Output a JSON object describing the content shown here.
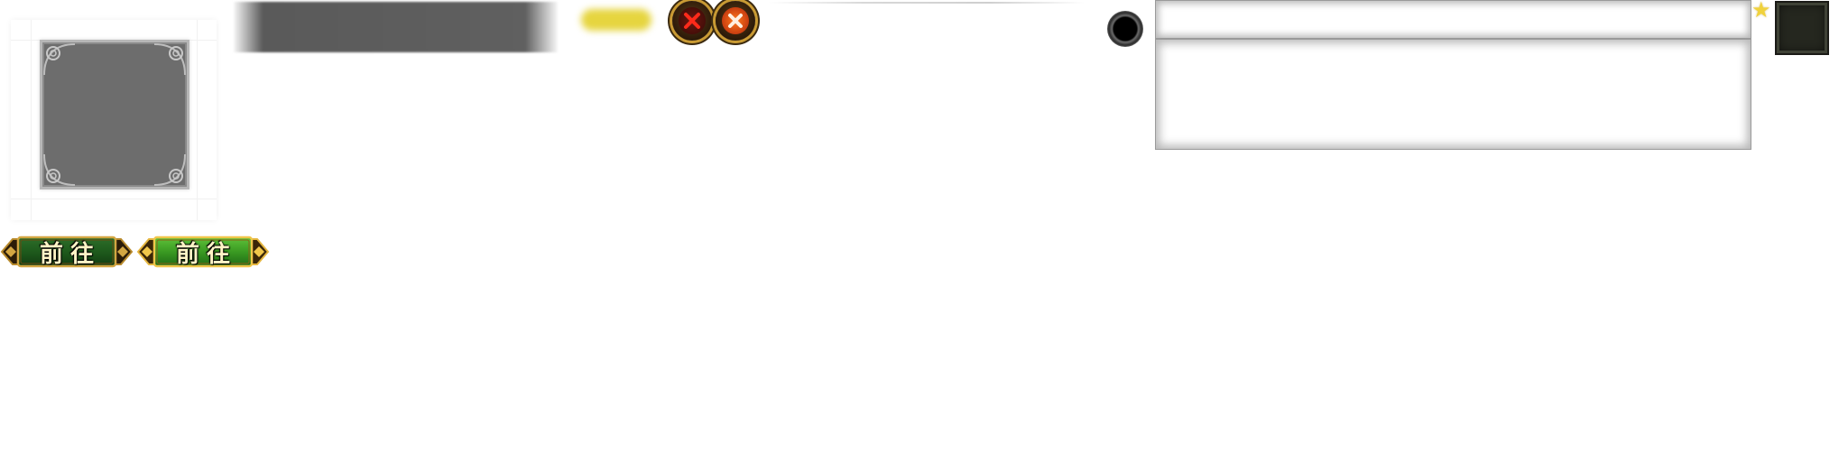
{
  "close_buttons": [
    {
      "icon": "x-icon",
      "state": "normal"
    },
    {
      "icon": "x-icon",
      "state": "hover"
    }
  ],
  "input_field": {
    "value": "",
    "placeholder": ""
  },
  "text_area": {
    "value": "",
    "placeholder": ""
  },
  "go_buttons": [
    {
      "label": "前往",
      "state": "normal"
    },
    {
      "label": "前往",
      "state": "highlighted"
    }
  ],
  "colors": {
    "gold_trim": "#c99a33",
    "button_green_normal": "#1e5a1c",
    "button_green_highlight": "#3a9a22",
    "label_cream": "#fff4c6",
    "star_yellow": "#f0d23c",
    "chip_yellow": "#e6d53f"
  }
}
